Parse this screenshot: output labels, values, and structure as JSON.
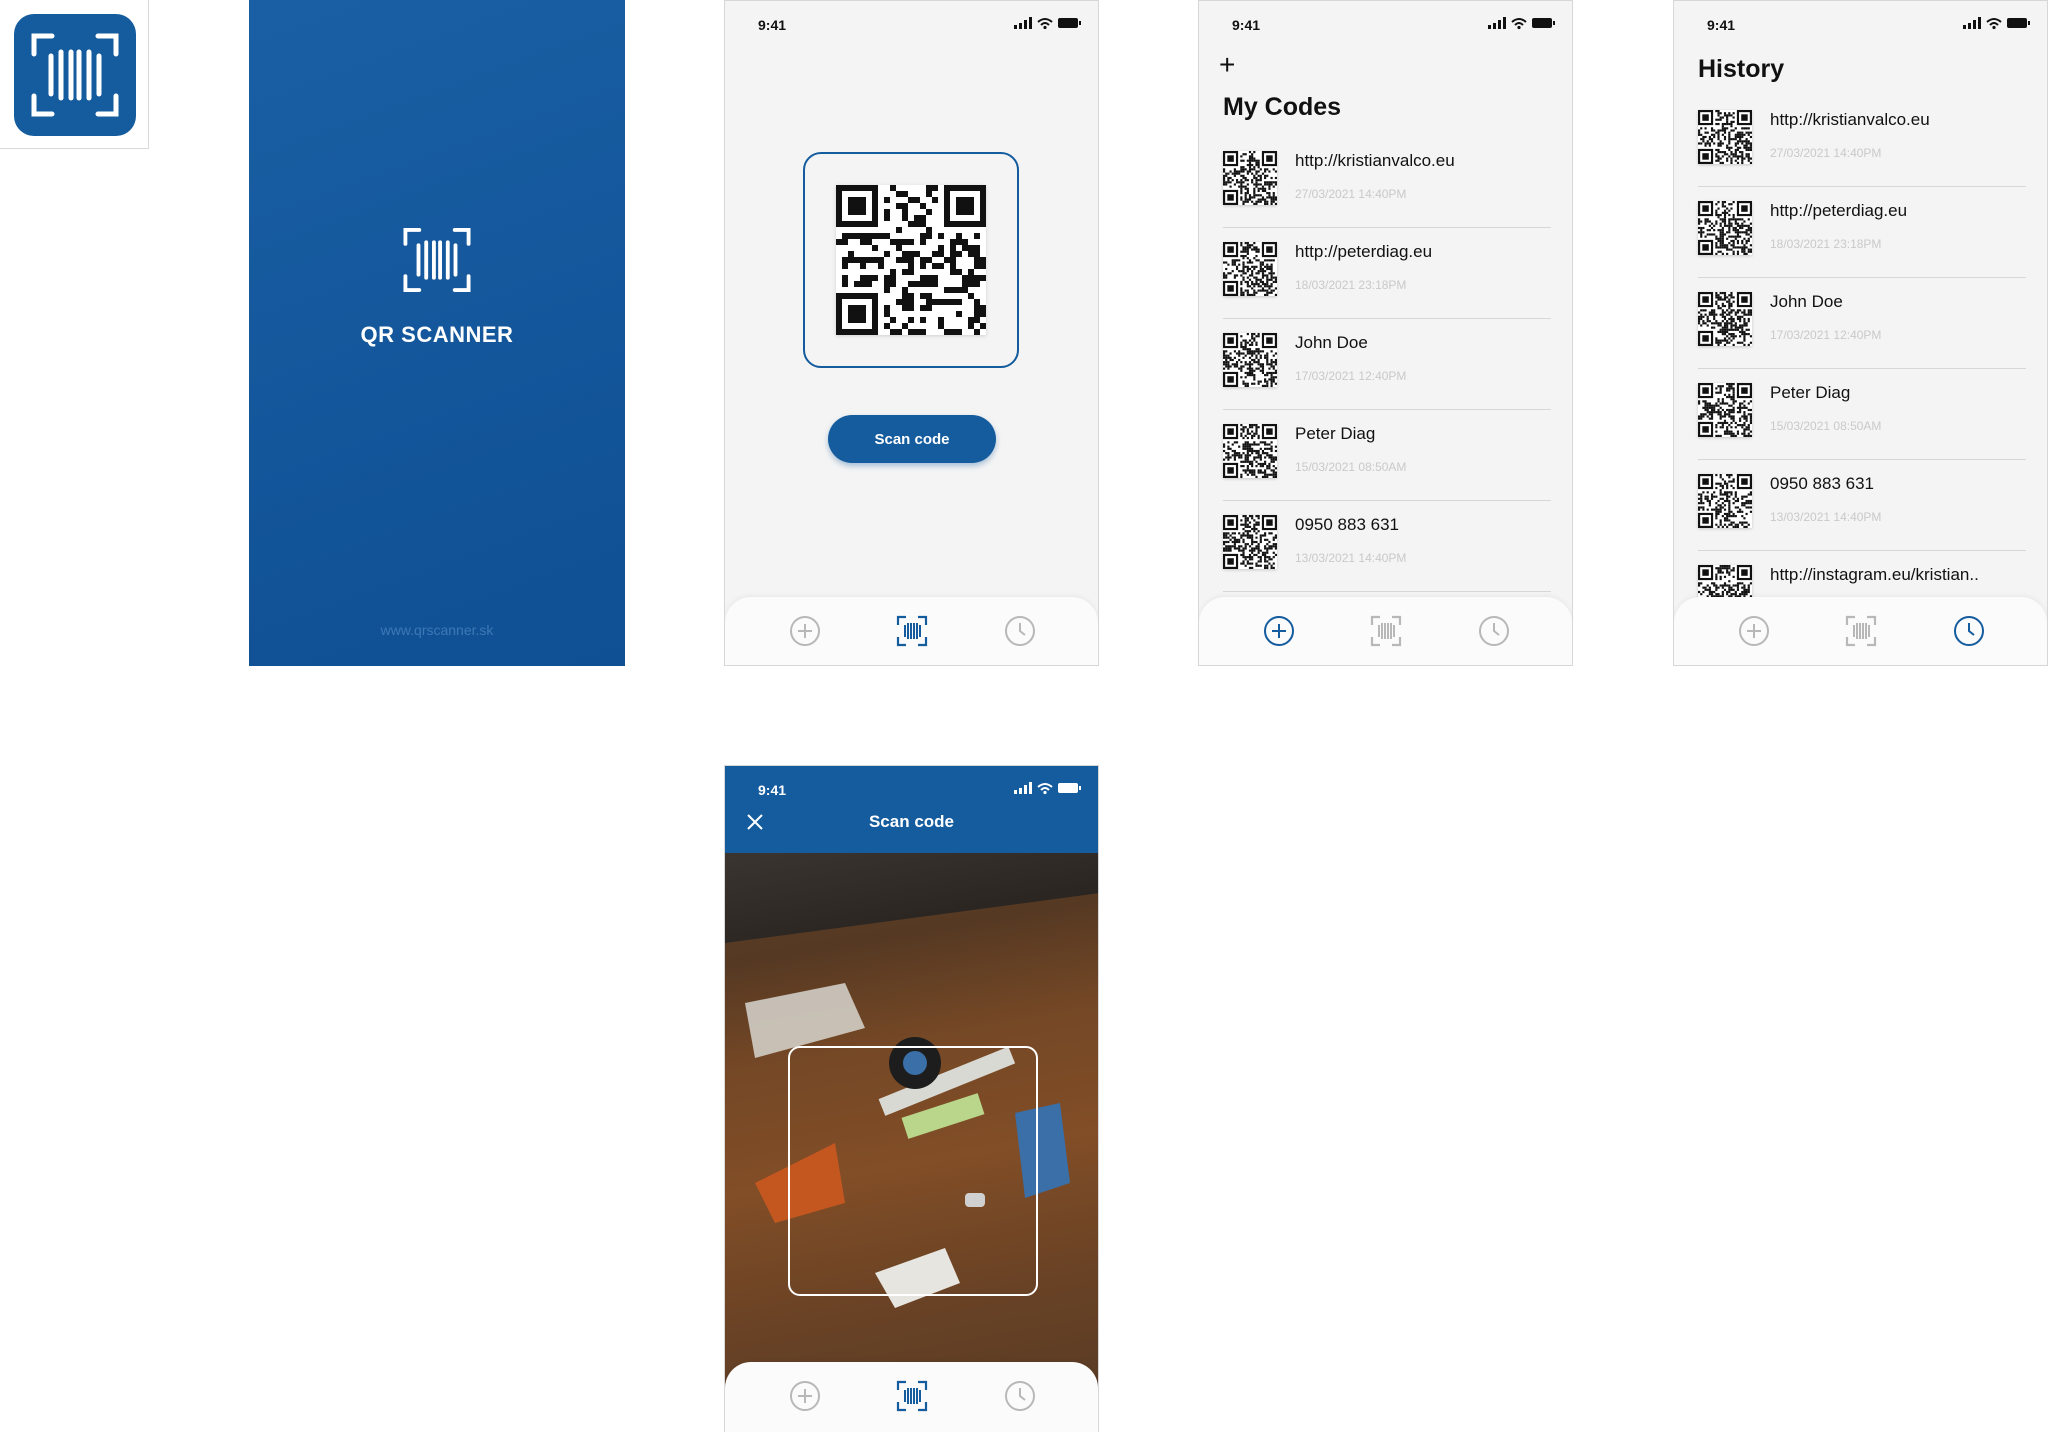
{
  "app": {
    "name": "QR SCANNER",
    "url": "www.qrscanner.sk",
    "brand_color": "#145C9E",
    "accent_muted": "#B8B8B8"
  },
  "status_bar": {
    "time": "9:41"
  },
  "scan_screen": {
    "button_label": "Scan code"
  },
  "my_codes": {
    "title": "My Codes",
    "add_icon": "plus-icon",
    "items": [
      {
        "title": "http://kristianvalco.eu",
        "date": "27/03/2021 14:40PM"
      },
      {
        "title": "http://peterdiag.eu",
        "date": "18/03/2021 23:18PM"
      },
      {
        "title": "John Doe",
        "date": "17/03/2021 12:40PM"
      },
      {
        "title": "Peter Diag",
        "date": "15/03/2021 08:50AM"
      },
      {
        "title": "0950 883 631",
        "date": "13/03/2021 14:40PM"
      }
    ]
  },
  "history": {
    "title": "History",
    "items": [
      {
        "title": "http://kristianvalco.eu",
        "date": "27/03/2021 14:40PM"
      },
      {
        "title": "http://peterdiag.eu",
        "date": "18/03/2021 23:18PM"
      },
      {
        "title": "John Doe",
        "date": "17/03/2021 12:40PM"
      },
      {
        "title": "Peter Diag",
        "date": "15/03/2021 08:50AM"
      },
      {
        "title": "0950 883 631",
        "date": "13/03/2021 14:40PM"
      },
      {
        "title": "http://instagram.eu/kristian..",
        "date": ""
      }
    ]
  },
  "camera_screen": {
    "title": "Scan code",
    "close_icon": "close-icon"
  },
  "tabs": [
    {
      "name": "add",
      "icon": "plus-circle-icon"
    },
    {
      "name": "scan",
      "icon": "barcode-scan-icon"
    },
    {
      "name": "history",
      "icon": "clock-icon"
    }
  ]
}
